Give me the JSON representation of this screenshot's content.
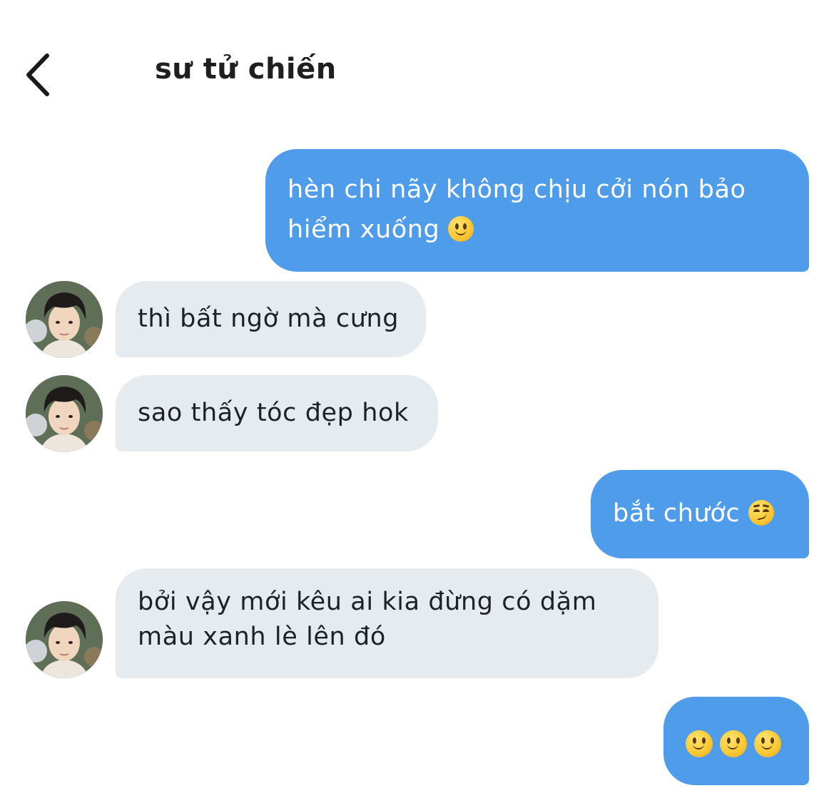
{
  "header": {
    "title": "sư tử chiến",
    "back_icon": "chevron-left-icon"
  },
  "colors": {
    "outgoing_bubble": "#4f9cea",
    "incoming_bubble": "#e6ebf0",
    "outgoing_text": "#ffffff",
    "incoming_text": "#1e2227"
  },
  "messages": [
    {
      "direction": "outgoing",
      "line1": "hèn chi nãy không chịu cởi nón bảo",
      "line2": "hiểm xuống",
      "emoji": "slightly-smiling-face-icon"
    },
    {
      "direction": "incoming",
      "text": "thì bất ngờ mà cưng"
    },
    {
      "direction": "incoming",
      "text": "sao thấy tóc đẹp hok"
    },
    {
      "direction": "outgoing",
      "text": "bắt chước",
      "emoji": "smirking-face-icon"
    },
    {
      "direction": "incoming",
      "line1": "bởi vậy mới kêu ai kia đừng có dặm",
      "line2": "màu xanh lè lên đó"
    },
    {
      "direction": "outgoing",
      "emojis": [
        "slightly-smiling-face-icon",
        "slightly-smiling-face-icon",
        "slightly-smiling-face-icon"
      ]
    }
  ]
}
